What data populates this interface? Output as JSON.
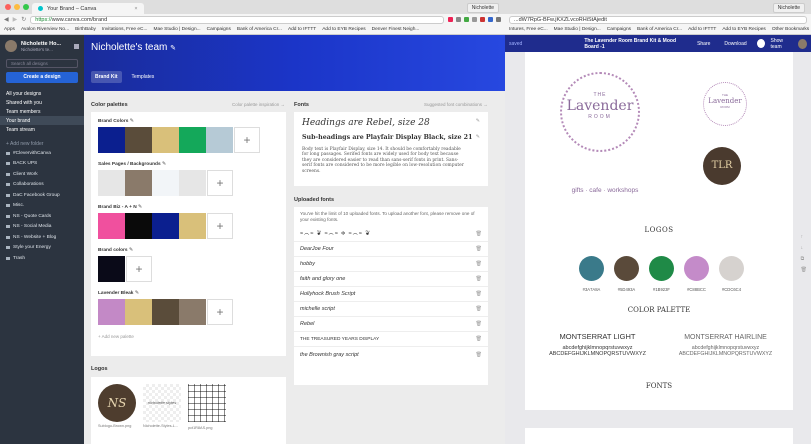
{
  "left_window": {
    "tab_title": "Your Brand – Canva",
    "profile": "Nicholette",
    "url_secure": "https://",
    "url_rest": "www.canva.com/brand",
    "bookmarks": [
      "Apps",
      "Avalon Riverview No...",
      "BirthBaby",
      "Invitations, Free eC...",
      "Mae Studio | Design...",
      "Campaigns",
      "Bank of America Cr...",
      "Add to IFTTT",
      "Add to EYB Recipes",
      "Denver Finest Neigh..."
    ]
  },
  "sidebar": {
    "user_name": "Nicholette Ho...",
    "user_sub": "Nicholette's te...",
    "search_placeholder": "Search all designs",
    "create_label": "Create a design",
    "nav": [
      "All your designs",
      "Shared with you",
      "Team members",
      "Your brand",
      "Team stream"
    ],
    "add_folder": "+ Add new folder",
    "folders": [
      "#ClevervithCanva",
      "BACK UPS",
      "Client Work",
      "Collaborations",
      "DaC Facebook Group",
      "Misc.",
      "NS - Quote Cards",
      "NS - Social Media",
      "NS - Website + Blog",
      "Style your Energy",
      "Trash"
    ]
  },
  "main": {
    "team_title": "Nicholette's team",
    "tabs": [
      "Brand Kit",
      "Templates"
    ],
    "color_palettes_title": "Color palettes",
    "color_palettes_link": "Color palette inspiration →",
    "palettes": [
      {
        "name": "Brand Colors",
        "colors": [
          "#0b1f8f",
          "#5a4c3a",
          "#d9c07a",
          "#14a85a",
          "#b6cad6"
        ]
      },
      {
        "name": "Sales Pages / Backgrounds",
        "colors": [
          "#e6e6e6",
          "#8a7a6a",
          "#f2f5f8",
          "#e6e6e6"
        ]
      },
      {
        "name": "Brand Biz - A + N",
        "colors": [
          "#f0509e",
          "#0a0a0a",
          "#0b1f8f",
          "#d9c07a"
        ]
      },
      {
        "name": "Brand colors",
        "colors": [
          "#0a0a18"
        ]
      },
      {
        "name": "Lavender Bleak",
        "colors": [
          "#c389c6",
          "#d9c07a",
          "#5a4c3a",
          "#8a7a6a"
        ]
      }
    ],
    "add_palette": "+ Add new palette",
    "fonts_title": "Fonts",
    "fonts_link": "Suggested font combinations →",
    "heading_sample": "Headings are Rebel, size 28",
    "subheading_sample": "Sub-headings are Playfair Display Black, size 21",
    "body_sample": "Body text is Playfair Display, size 14. It should be comfortably readable for long passages. Serifed fonts are widely used for body text because they are considered easier to read than sans-serif fonts in print. Sans-serif fonts are considered to be more legible on low-resolution computer screens.",
    "uploaded_title": "Uploaded fonts",
    "uploaded_note": "You've hit the limit of 10 uploaded fonts. To upload another font, please remove one of your existing fonts.",
    "uploaded_fonts": [
      "Saints & Beasts ornaments",
      "DearJoe Four",
      "hobby",
      "faith and glory one",
      "Hollyhock Brush Script",
      "michelle script",
      "Rebel",
      "THE TREASURED YEARS DISPLAY",
      "the Brownish gray script"
    ],
    "logos_title": "Logos",
    "logos": [
      "Sublogo-Brown.png",
      "Nicholette-Styles-L...",
      "pct1R8AS.png"
    ]
  },
  "right_window": {
    "profile": "Nicholette",
    "url": "...dW7RpG-BFw.jKXZLvcoRHiStAjedit",
    "bookmarks": [
      "Intures, Free eC...",
      "Mae Studio | Design...",
      "Campaigns",
      "Bank of America Cr...",
      "Add to IFTTT",
      "Add to EYB Recipes",
      "Other Bookmarks"
    ],
    "app_saved": "saved",
    "doc_title": "The Lavender Room Brand Kit & Mood Board -1",
    "share": "Share",
    "download": "Download",
    "show_team": "Show team",
    "logo_the": "THE",
    "logo_name": "Lavender",
    "logo_room": "ROOM",
    "logo_tagline": "gifts · cafe · workshops",
    "small_logo_the": "THE",
    "small_logo_name": "Lavender",
    "small_logo_room": "ROOM",
    "dark_logo": "TLR",
    "logos_heading": "LOGOS",
    "palette_heading": "COLOR PALETTE",
    "colors": [
      {
        "hex": "#3a7a8a",
        "label": "#3A7A8A"
      },
      {
        "hex": "#5a4a3a",
        "label": "#5D493A"
      },
      {
        "hex": "#1f8a47",
        "label": "#1B923F"
      },
      {
        "hex": "#c48bc9",
        "label": "#C88BCC"
      },
      {
        "hex": "#d6d2cf",
        "label": "#CDC6C4"
      }
    ],
    "font1_name": "MONTSERRAT LIGHT",
    "font1_lower": "abcdefghijklmnopqrstuvwxyz",
    "font1_upper": "ABCDEFGHIJKLMNOPQRSTUVWXYZ",
    "font2_name": "MONTSERRAT HAIRLINE",
    "font2_lower": "abcdefghijklmnopqrstuvwxyz",
    "font2_upper": "ABCDEFGHIJKLMNOPQRSTUVWXYZ",
    "fonts_heading": "FONTS"
  }
}
